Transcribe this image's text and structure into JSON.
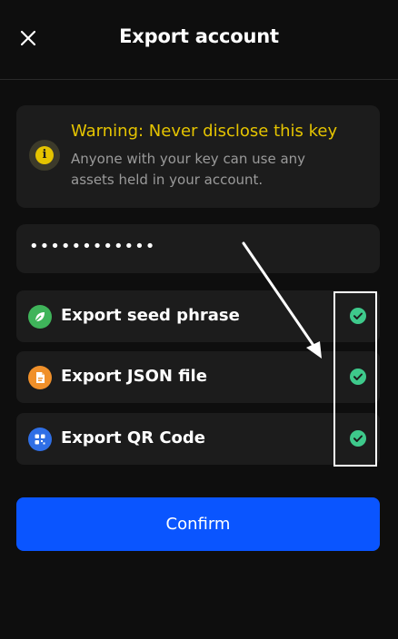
{
  "header": {
    "title": "Export account",
    "close_icon": "close-icon"
  },
  "warning": {
    "icon": "info-icon",
    "icon_glyph": "i",
    "title": "Warning: Never disclose this key",
    "body": "Anyone with your key can use any assets held in your account.",
    "color": "#e5c400"
  },
  "password": {
    "value": "••••••••••••"
  },
  "options": [
    {
      "label": "Export seed phrase",
      "icon": "leaf-icon",
      "color": "#3fb45a",
      "checked": true
    },
    {
      "label": "Export JSON file",
      "icon": "file-icon",
      "color": "#f0902a",
      "checked": true
    },
    {
      "label": "Export QR Code",
      "icon": "qr-code-icon",
      "color": "#2f6fe6",
      "checked": true
    }
  ],
  "check_color": "#3ec98b",
  "confirm": {
    "label": "Confirm",
    "color": "#0a55ff"
  }
}
